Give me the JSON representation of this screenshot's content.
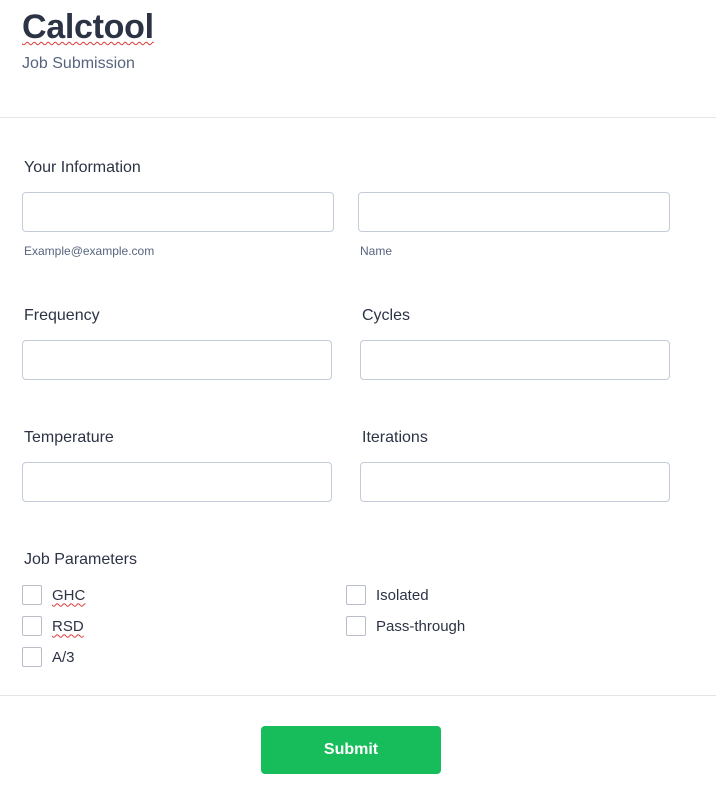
{
  "header": {
    "title": "Calctool",
    "subtitle": "Job Submission"
  },
  "your_information": {
    "heading": "Your Information",
    "email": {
      "value": "",
      "sublabel": "Example@example.com"
    },
    "name": {
      "value": "",
      "sublabel": "Name"
    }
  },
  "fields": {
    "frequency": {
      "label": "Frequency",
      "value": ""
    },
    "cycles": {
      "label": "Cycles",
      "value": ""
    },
    "temperature": {
      "label": "Temperature",
      "value": ""
    },
    "iterations": {
      "label": "Iterations",
      "value": ""
    }
  },
  "job_parameters": {
    "heading": "Job Parameters",
    "options": [
      {
        "label": "GHC",
        "checked": false
      },
      {
        "label": "RSD",
        "checked": false
      },
      {
        "label": "A/3",
        "checked": false
      },
      {
        "label": "Isolated",
        "checked": false
      },
      {
        "label": "Pass-through",
        "checked": false
      }
    ]
  },
  "submit": {
    "label": "Submit"
  },
  "colors": {
    "accent": "#18bd5b",
    "text": "#2c3345",
    "muted": "#57647e",
    "border": "#c3cad8"
  }
}
